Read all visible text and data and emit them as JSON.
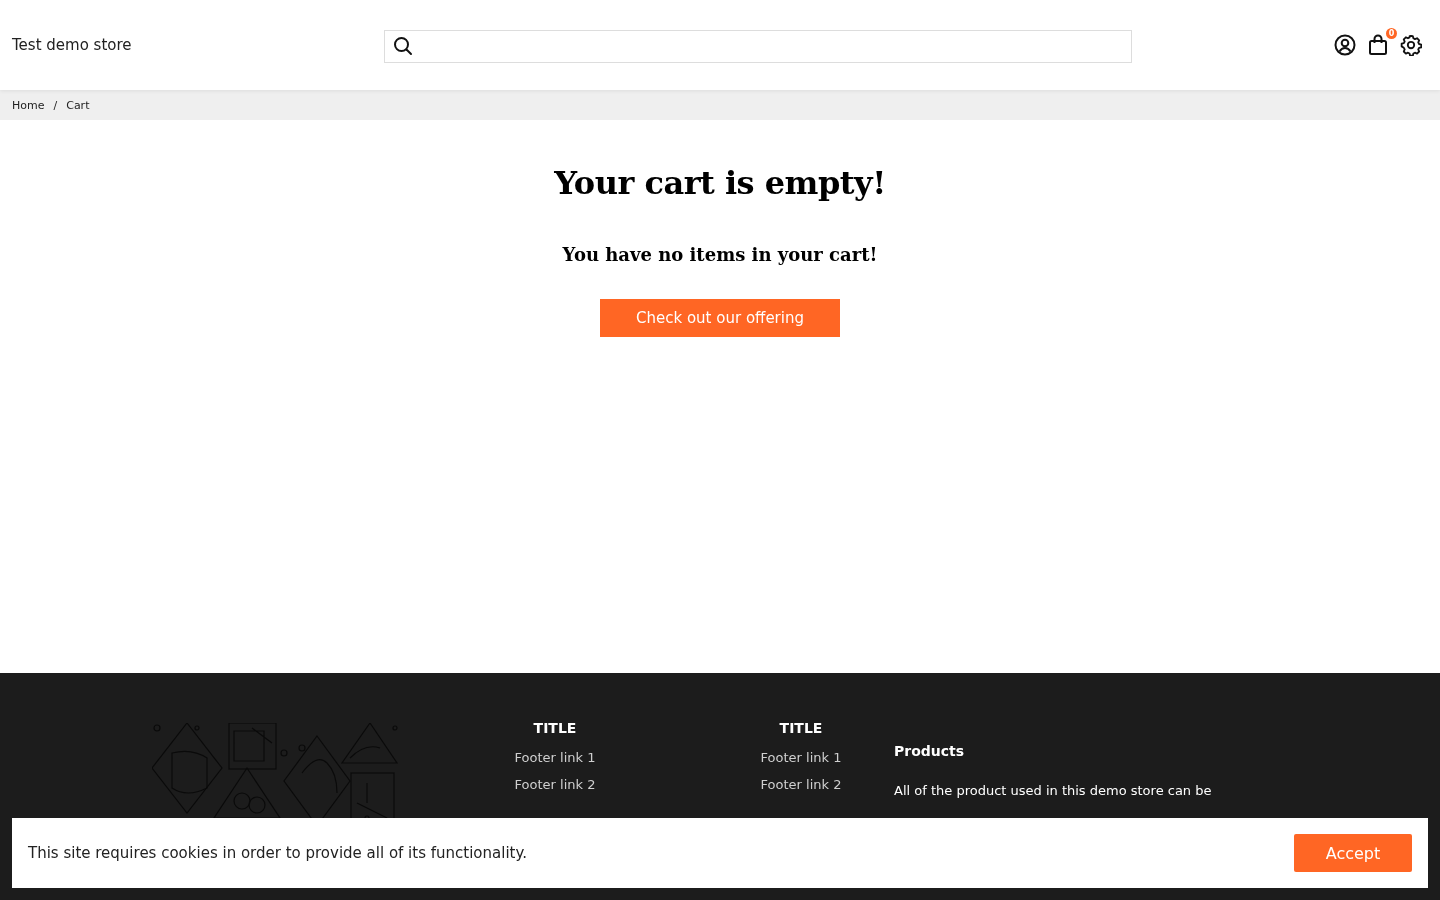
{
  "header": {
    "store_name": "Test demo store",
    "cart_count": "0"
  },
  "breadcrumb": [
    "Home",
    "/",
    "Cart"
  ],
  "main": {
    "title": "Your cart is empty!",
    "subtitle": "You have no items in your cart!",
    "button": "Check out our offering"
  },
  "footer": {
    "columns": [
      {
        "title": "TITLE",
        "links": [
          "Footer link 1",
          "Footer link 2"
        ]
      },
      {
        "title": "TITLE",
        "links": [
          "Footer link 1",
          "Footer link 2"
        ]
      }
    ],
    "about": {
      "title": "Products",
      "text": "All of the product used in this demo store can be"
    }
  },
  "cookie_banner": {
    "message": "This site requires cookies in order to provide all of its functionality.",
    "button": "Accept"
  }
}
